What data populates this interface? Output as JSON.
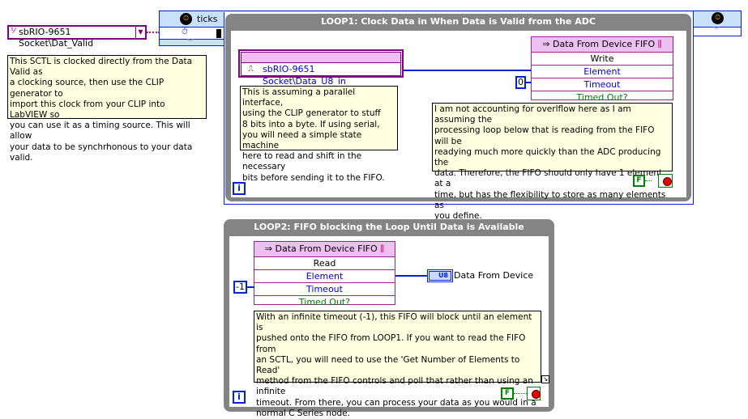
{
  "clock_source": {
    "label": "sbRIO-9651 Socket\\Dat_Valid"
  },
  "timing": {
    "ticks_label": "ticks"
  },
  "comments": {
    "sctl": "This SCTL is clocked directly from the Data Valid as\na clocking source, then use the CLIP generator to\nimport this clock from your CLIP into LabVIEW so\nyou can use it as a timing source. This will allow\nyour data to be synchrhonous to your data valid.",
    "parallel": "This is assuming a parallel interface,\nusing the CLIP generator to stuff\n8 bits into a byte. If using serial,\nyou will need a simple state machine\nhere to read and shift in the necessary\nbits before sending it to the FIFO.",
    "overflow": "I am not accounting for overlflow here as I am assuming the\nprocessing loop below that is reading from the FIFO will be\nreadying much more quickly than the ADC producing the\ndata. Therefore, the FIFO should only have 1 element at a\ntime, but has the flexibility to store as many elements as\nyou define.",
    "infinite": "With an infinite timeout (-1), this FIFO will block until an element is\npushed onto the FIFO from LOOP1. If you want to read the FIFO from\nan SCTL, you will need to use the 'Get Number of Elements to Read'\nmethod from the FIFO controls and poll that rather than using an infinite\ntimeout. From there, you can process your data as you would in a\nnormal C Series node."
  },
  "loop1": {
    "title": "LOOP1: Clock Data in When Data is Valid from the ADC",
    "io_node": "sbRIO-9651 Socket\\Data_U8_in",
    "fifo": {
      "name": "Data From Device FIFO",
      "method": "Write",
      "rows": [
        "Element",
        "Timeout",
        "Timed Out?"
      ]
    },
    "timeout_const": "0",
    "stop_const": "F",
    "iter": "i"
  },
  "loop2": {
    "title": "LOOP2: FIFO blocking the Loop Until Data is Available",
    "fifo": {
      "name": "Data From Device FIFO",
      "method": "Read",
      "rows": [
        "Element",
        "Timeout",
        "Timed Out?"
      ]
    },
    "timeout_const": "-1",
    "indicator_type": "U8",
    "indicator_label": "Data From Device",
    "stop_const": "F",
    "iter": "i"
  }
}
